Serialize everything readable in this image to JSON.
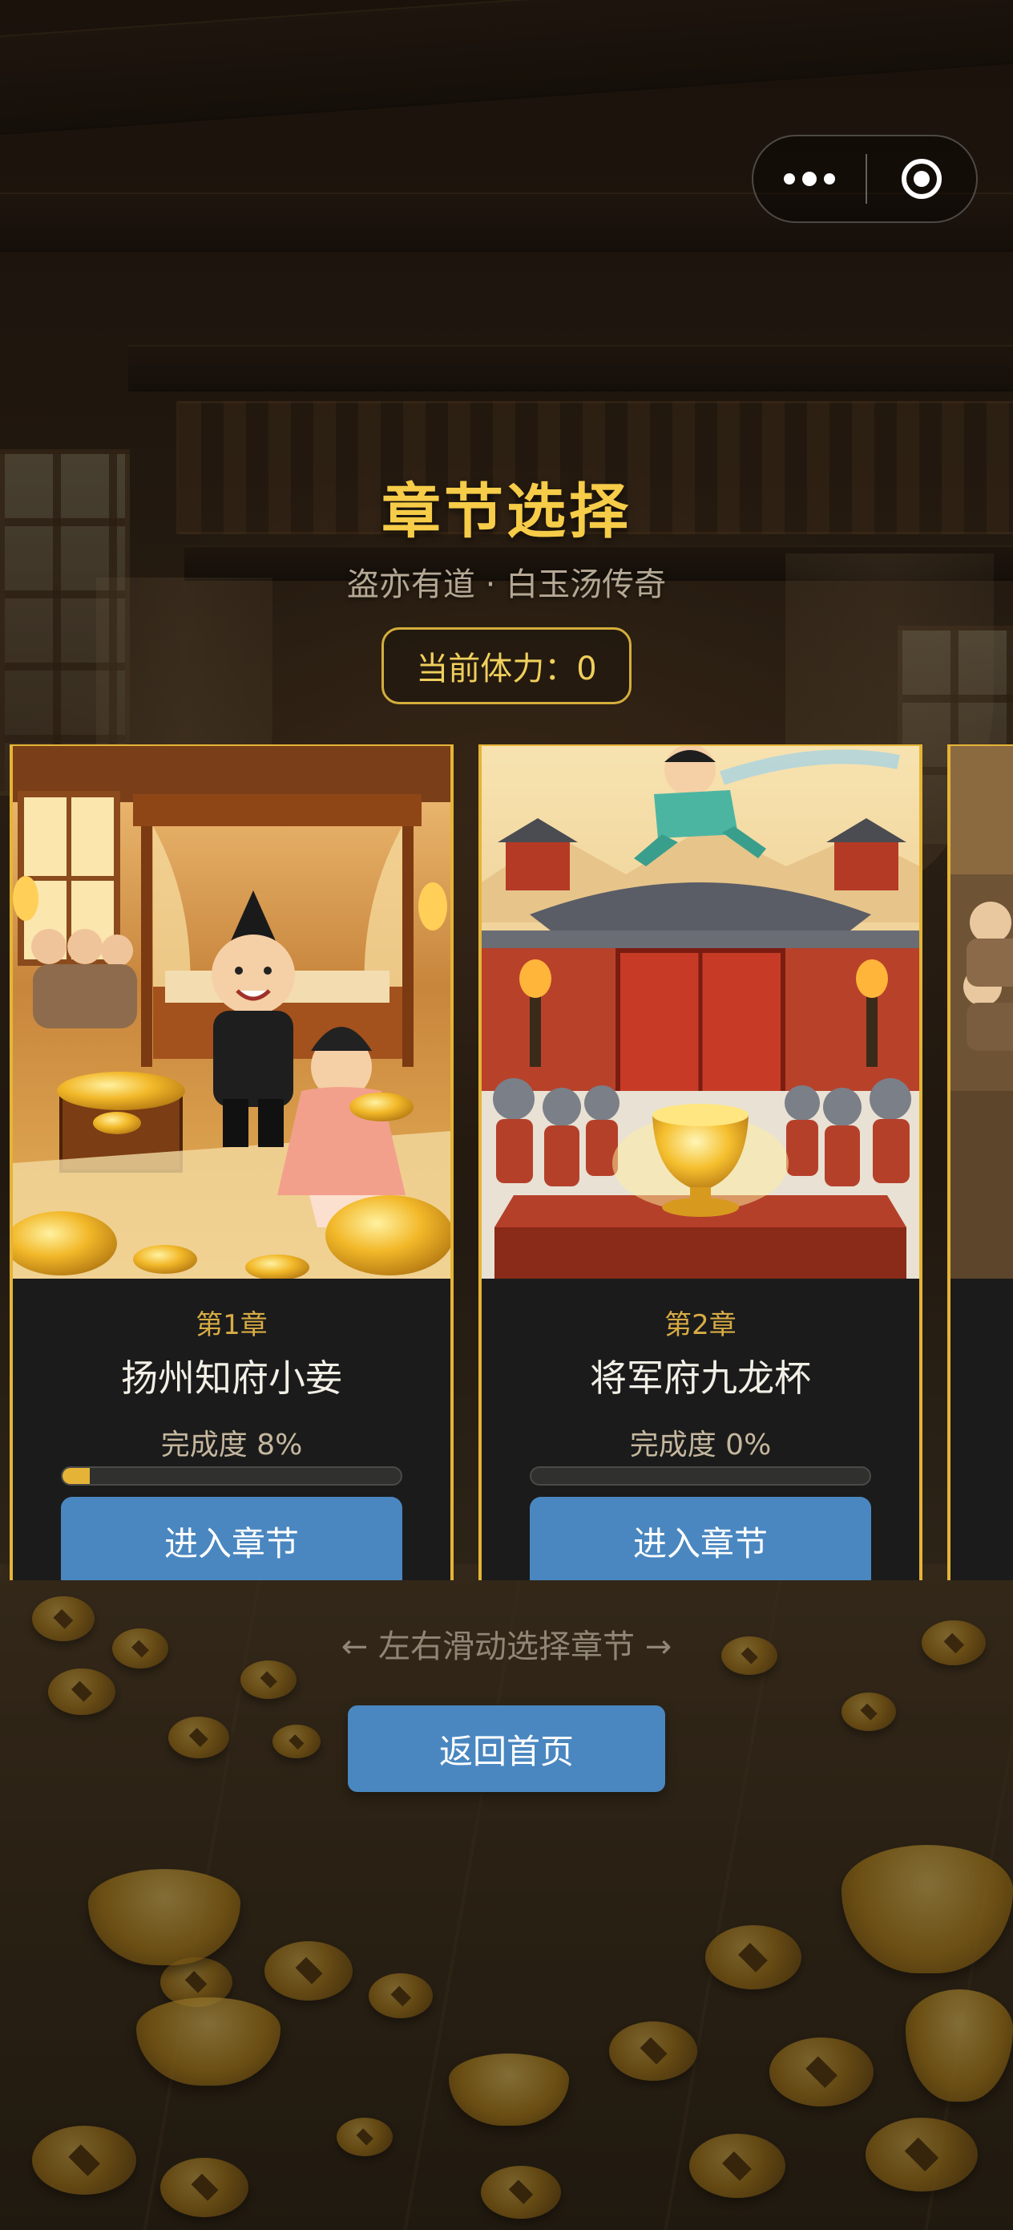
{
  "capsule": {
    "more_icon": "more-dots-icon",
    "close_icon": "target-ring-icon"
  },
  "header": {
    "title": "章节选择",
    "subtitle": "盗亦有道 · 白玉汤传奇",
    "stamina": "当前体力：0"
  },
  "chapters": [
    {
      "number": "第1章",
      "name": "扬州知府小妾",
      "progress_label": "完成度 8%",
      "progress": 0.08,
      "button": "进入章节"
    },
    {
      "number": "第2章",
      "name": "将军府九龙杯",
      "progress_label": "完成度 0%",
      "progress": 0.0,
      "button": "进入章节"
    }
  ],
  "footer": {
    "swipe_hint": "← 左右滑动选择章节 →",
    "home_button": "返回首页"
  },
  "colors": {
    "accent_gold": "#e5b436",
    "title_gold": "#f6cc48",
    "button_blue": "#4a87c0",
    "card_bg": "#1b1b1b"
  }
}
